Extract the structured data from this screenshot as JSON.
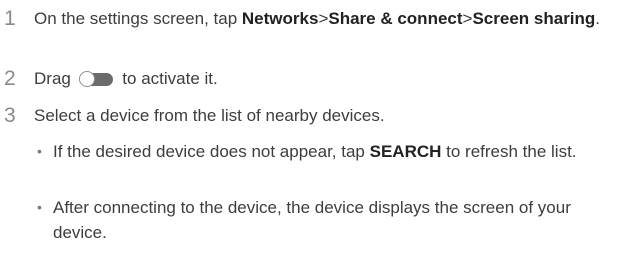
{
  "steps": [
    {
      "number": "1",
      "prefix": "On the settings screen, tap ",
      "path": [
        "Networks",
        "Share & connect",
        "Screen sharing"
      ],
      "separator": ">",
      "suffix": "."
    },
    {
      "number": "2",
      "before": "Drag ",
      "after": " to activate it.",
      "icon": "toggle-switch-icon"
    },
    {
      "number": "3",
      "text": "Select a device from the list of nearby devices."
    }
  ],
  "bullets": [
    {
      "marker": "•",
      "before": "If the desired device does not appear, tap ",
      "keyword": "SEARCH",
      "after": " to refresh the list."
    },
    {
      "marker": "•",
      "text": "After connecting to the device, the device displays the screen of your device."
    }
  ],
  "colors": {
    "text": "#3d3d3d",
    "bold_text": "#222222",
    "step_number": "#8a8a8a",
    "toggle_track": "#6b6b6b",
    "toggle_knob": "#ffffff"
  }
}
